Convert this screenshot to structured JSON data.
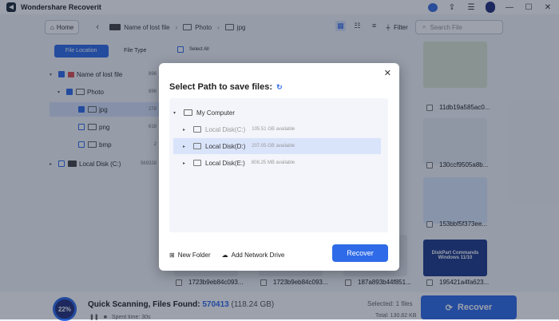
{
  "app": {
    "title": "Wondershare Recoverit"
  },
  "nav": {
    "home_label": "Home",
    "breadcrumb": [
      "Name of lost file",
      "Photo",
      "jpg"
    ],
    "filter_label": "Filter",
    "search_placeholder": "Search File"
  },
  "sidebar": {
    "tabs": [
      "File Location",
      "File Type"
    ],
    "tree": [
      {
        "label": "Name of lost file",
        "count": "896"
      },
      {
        "label": "Photo",
        "count": "896"
      },
      {
        "label": "jpg",
        "count": "278"
      },
      {
        "label": "png",
        "count": "618"
      },
      {
        "label": "bmp",
        "count": "2"
      },
      {
        "label": "Local Disk (C:)",
        "count": "569328"
      }
    ]
  },
  "main": {
    "select_all": "Select All",
    "files": [
      "11db19a585ac0...",
      "130ccf9505a8b...",
      "153bbf5f373ee...",
      "1723b9eb84c093...",
      "1723b9eb84c093...",
      "187a893b44f851...",
      "195421a4fa623..."
    ],
    "thumb_text": "DiskPart Commands Windows 11/10"
  },
  "dialog": {
    "title": "Select Path to save files:",
    "root": "My Computer",
    "disks": [
      {
        "name": "Local Disk(C:)",
        "available": "105.51 GB available"
      },
      {
        "name": "Local Disk(D:)",
        "available": "207.05 GB available"
      },
      {
        "name": "Local Disk(E:)",
        "available": "808.25 MB available"
      }
    ],
    "new_folder": "New Folder",
    "add_network": "Add Network Drive",
    "recover": "Recover"
  },
  "status": {
    "progress": "22%",
    "scan_label": "Quick Scanning, Files Found:",
    "files_found": "570413",
    "size": "(118.24 GB)",
    "spent_time": "Spent time: 30s",
    "selected": "Selected: 1 files",
    "total": "Total: 130.82 KB",
    "recover": "Recover"
  },
  "colors": {
    "accent": "#2f6be8",
    "overlay": "rgba(20,30,55,0.42)"
  }
}
